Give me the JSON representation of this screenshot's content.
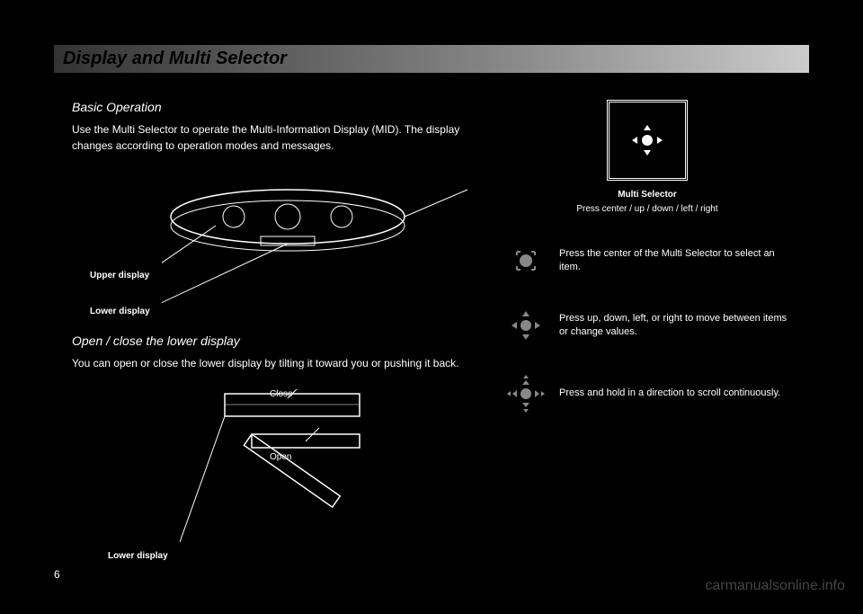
{
  "header": {
    "title": "Display and Multi Selector"
  },
  "main": {
    "subtitle1": "Basic Operation",
    "paragraph1": "Use the Multi Selector to operate the Multi-Information Display (MID). The display changes according to operation modes and messages.",
    "labels": {
      "upper_display": "Upper display",
      "lower_display": "Lower display",
      "close": "Close",
      "open": "Open"
    },
    "subtitle2": "Open / close the lower display",
    "paragraph2": "You can open or close the lower display by tilting it toward you or pushing it back."
  },
  "callout": {
    "selector_label": "Multi Selector",
    "selector_action": "Press center / up / down / left / right"
  },
  "icons": [
    {
      "name": "press-center-icon",
      "desc": "Press the center of the Multi Selector to select an item."
    },
    {
      "name": "press-direction-icon",
      "desc": "Press up, down, left, or right to move between items or change values."
    },
    {
      "name": "press-hold-icon",
      "desc": "Press and hold in a direction to scroll continuously."
    }
  ],
  "page_number": "6",
  "watermark": "carmanualsonline.info"
}
